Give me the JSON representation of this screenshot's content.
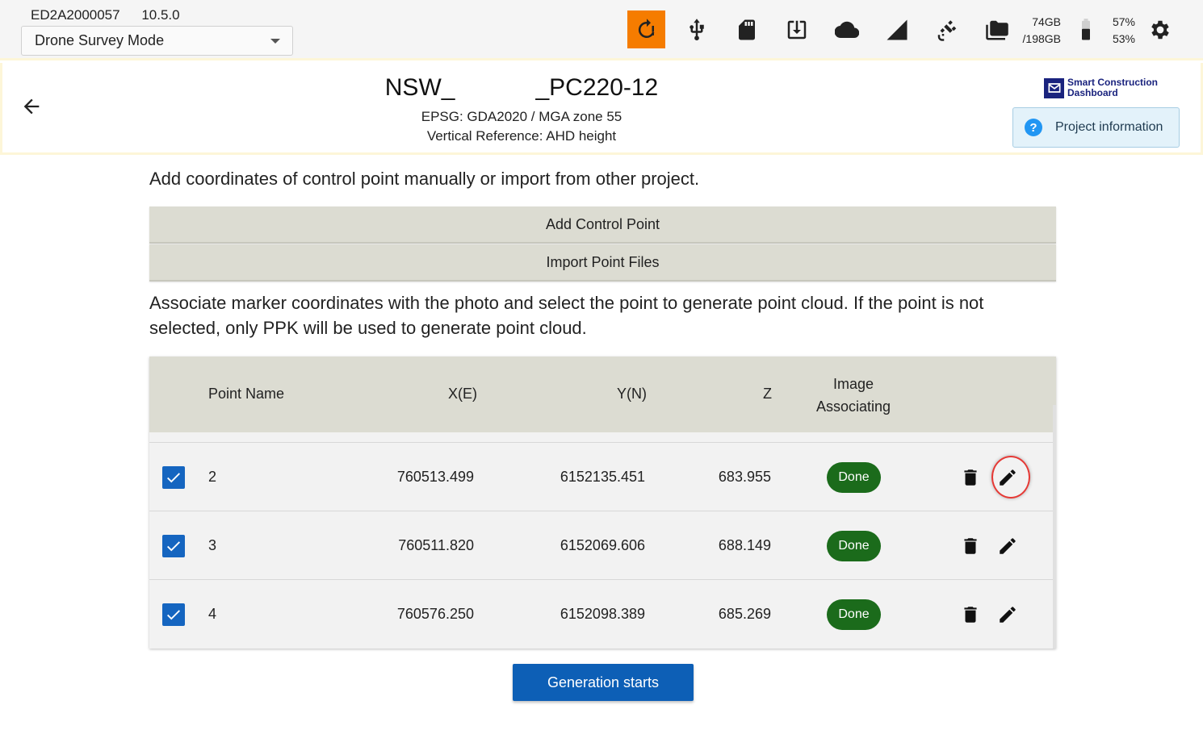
{
  "status_bar": {
    "device_id": "ED2A2000057",
    "version": "10.5.0",
    "mode": "Drone Survey Mode",
    "storage_used": "74GB",
    "storage_total": "/198GB",
    "battery_1": "57%",
    "battery_2": "53%",
    "icons": [
      "sync-alert-icon",
      "usb-icon",
      "sd-card-icon",
      "download-icon",
      "cloud-icon",
      "signal-icon",
      "satellite-icon",
      "folder-icon",
      "battery-icon",
      "settings-icon"
    ],
    "alert_color": "#f57c00"
  },
  "header": {
    "title": "NSW_            _PC220-12",
    "epsg": "EPSG: GDA2020 / MGA zone 55",
    "vertical_reference": "Vertical Reference: AHD height",
    "logo_line1": "Smart Construction",
    "logo_line2": "Dashboard",
    "project_info_label": "Project information"
  },
  "main": {
    "intro_text": "Add coordinates of control point manually or import from other project.",
    "add_control_point_label": "Add Control Point",
    "import_point_files_label": "Import Point Files",
    "associate_text": "Associate marker coordinates with the photo and select the point to generate point cloud. If the point is not selected, only PPK will be used to generate point cloud.",
    "table": {
      "headers": {
        "point_name": "Point Name",
        "x": "X(E)",
        "y": "Y(N)",
        "z": "Z",
        "image_line1": "Image",
        "image_line2": "Associating"
      },
      "rows": [
        {
          "checked": true,
          "name": "2",
          "x": "760513.499",
          "y": "6152135.451",
          "z": "683.955",
          "status": "Done"
        },
        {
          "checked": true,
          "name": "3",
          "x": "760511.820",
          "y": "6152069.606",
          "z": "688.149",
          "status": "Done"
        },
        {
          "checked": true,
          "name": "4",
          "x": "760576.250",
          "y": "6152098.389",
          "z": "685.269",
          "status": "Done"
        }
      ]
    },
    "generate_label": "Generation starts"
  },
  "colors": {
    "primary": "#0d5fb6",
    "done_badge": "#1b6b1b",
    "button_bg": "#dcdcd2"
  }
}
